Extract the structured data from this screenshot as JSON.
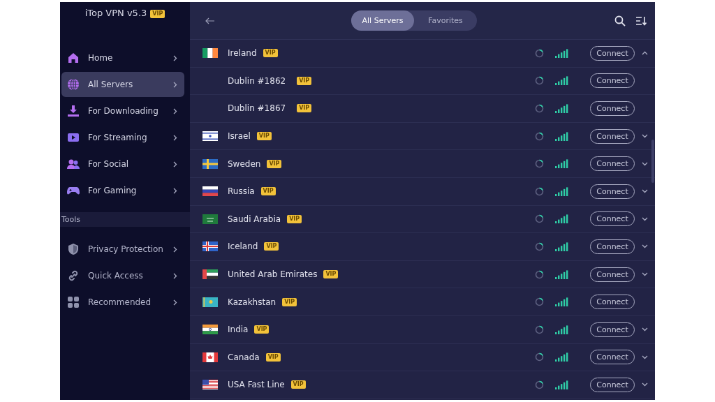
{
  "app": {
    "title": "iTop VPN v5.3",
    "badge": "VIP"
  },
  "sidebar": {
    "items": [
      {
        "label": "Home",
        "selected": false
      },
      {
        "label": "All Servers",
        "selected": true
      },
      {
        "label": "For Downloading",
        "selected": false
      },
      {
        "label": "For Streaming",
        "selected": false
      },
      {
        "label": "For Social",
        "selected": false
      },
      {
        "label": "For Gaming",
        "selected": false
      }
    ],
    "tools_heading": "Tools",
    "tools": [
      {
        "label": "Privacy Protection",
        "selected": false
      },
      {
        "label": "Quick Access",
        "selected": false
      },
      {
        "label": "Recommended",
        "selected": false
      }
    ]
  },
  "tabs": [
    {
      "label": "All Servers",
      "selected": true
    },
    {
      "label": "Favorites",
      "selected": false
    }
  ],
  "rows": [
    {
      "kind": "country",
      "name": "Ireland",
      "badge": "VIP",
      "button": "Connect",
      "expanded": true
    },
    {
      "kind": "server",
      "name": "Dublin #1862",
      "badge": "VIP",
      "button": "Connect"
    },
    {
      "kind": "server",
      "name": "Dublin #1867",
      "badge": "VIP",
      "button": "Connect"
    },
    {
      "kind": "country",
      "name": "Israel",
      "badge": "VIP",
      "button": "Connect",
      "expanded": false
    },
    {
      "kind": "country",
      "name": "Sweden",
      "badge": "VIP",
      "button": "Connect",
      "expanded": false
    },
    {
      "kind": "country",
      "name": "Russia",
      "badge": "VIP",
      "button": "Connect",
      "expanded": false
    },
    {
      "kind": "country",
      "name": "Saudi Arabia",
      "badge": "VIP",
      "button": "Connect",
      "expanded": false
    },
    {
      "kind": "country",
      "name": "Iceland",
      "badge": "VIP",
      "button": "Connect",
      "expanded": false
    },
    {
      "kind": "country",
      "name": "United Arab Emirates",
      "badge": "VIP",
      "button": "Connect",
      "expanded": false
    },
    {
      "kind": "country",
      "name": "Kazakhstan",
      "badge": "VIP",
      "button": "Connect"
    },
    {
      "kind": "country",
      "name": "India",
      "badge": "VIP",
      "button": "Connect",
      "expanded": false
    },
    {
      "kind": "country",
      "name": "Canada",
      "badge": "VIP",
      "button": "Connect",
      "expanded": false
    },
    {
      "kind": "country",
      "name": "USA Fast Line",
      "badge": "VIP",
      "button": "Connect",
      "expanded": false
    }
  ]
}
